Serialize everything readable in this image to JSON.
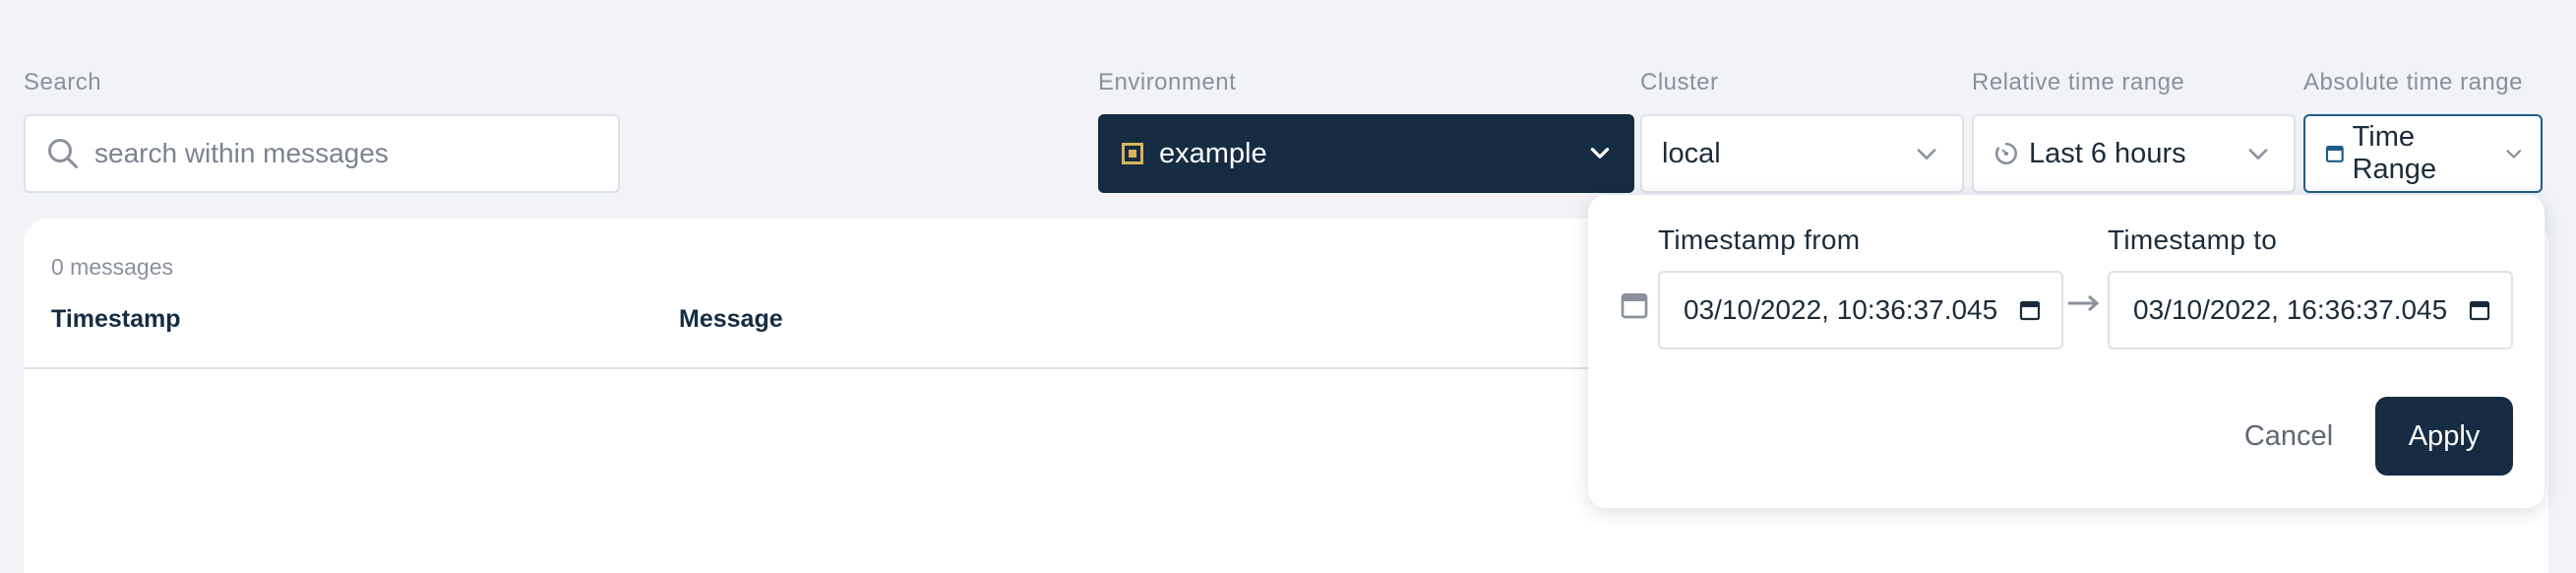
{
  "filters": {
    "search": {
      "label": "Search",
      "placeholder": "search within messages",
      "value": ""
    },
    "environment": {
      "label": "Environment",
      "value": "example"
    },
    "cluster": {
      "label": "Cluster",
      "value": "local"
    },
    "relative_time": {
      "label": "Relative time range",
      "value": "Last 6 hours"
    },
    "absolute_time": {
      "label": "Absolute time range",
      "value": "Time Range"
    }
  },
  "results": {
    "count_text": "0 messages",
    "columns": [
      "Timestamp",
      "Message"
    ]
  },
  "time_popover": {
    "from_label": "Timestamp from",
    "from_value": "03/10/2022, 10:36:37.045",
    "to_label": "Timestamp to",
    "to_value": "03/10/2022, 16:36:37.045",
    "cancel_label": "Cancel",
    "apply_label": "Apply"
  },
  "colors": {
    "primary": "#152c42",
    "accent": "#d8b45a",
    "focus_border": "#1f5c8a",
    "background": "#f1f3f7"
  }
}
